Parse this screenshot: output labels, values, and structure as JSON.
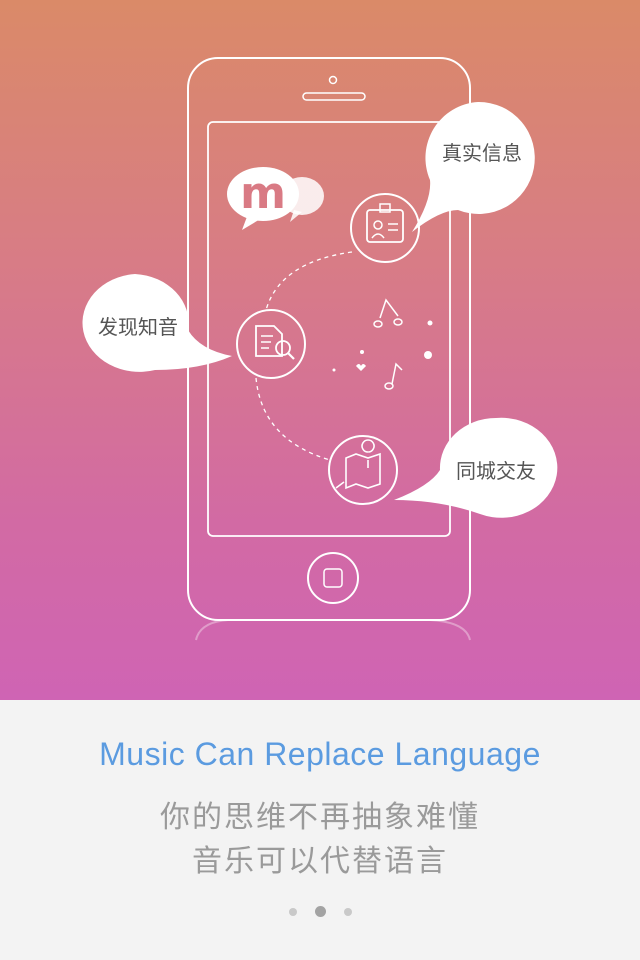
{
  "hero": {
    "bubbles": [
      {
        "label": "真实信息"
      },
      {
        "label": "发现知音"
      },
      {
        "label": "同城交友"
      }
    ],
    "app_logo_letter": "m"
  },
  "footer": {
    "headline": "Music Can Replace Language",
    "subline1": "你的思维不再抽象难懂",
    "subline2": "音乐可以代替语言"
  },
  "pager": {
    "count": 3,
    "active_index": 1
  },
  "colors": {
    "gradient_top": "#da8a68",
    "gradient_bottom": "#cf64b4",
    "headline": "#5b9be0"
  }
}
